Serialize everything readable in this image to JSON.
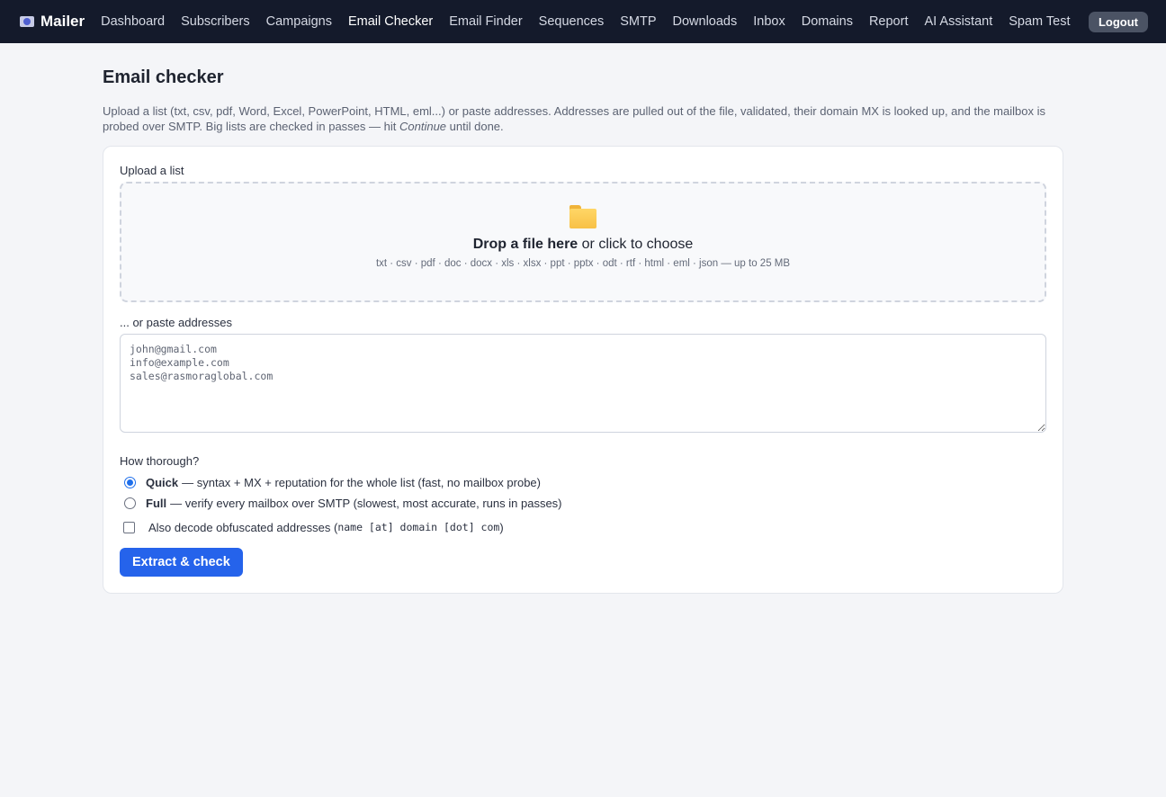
{
  "nav": {
    "brand": "Mailer",
    "links": [
      "Dashboard",
      "Subscribers",
      "Campaigns",
      "Email Checker",
      "Email Finder",
      "Sequences",
      "SMTP",
      "Downloads",
      "Inbox",
      "Domains",
      "Report",
      "AI Assistant",
      "Spam Test"
    ],
    "active": "Email Checker",
    "logout_label": "Logout"
  },
  "page": {
    "title": "Email checker",
    "desc_main": "Upload a list (txt, csv, pdf, Word, Excel, PowerPoint, HTML, eml...) or paste addresses. Addresses are pulled out of the file, validated, their domain MX is looked up, and the mailbox is probed over SMTP. Big lists are checked in passes — hit ",
    "desc_emphasis": "Continue",
    "desc_tail": " until done."
  },
  "upload": {
    "label": "Upload a list",
    "drop_bold": "Drop a file here",
    "drop_rest": " or click to choose",
    "formats": "txt · csv · pdf · doc · docx · xls · xlsx · ppt · pptx · odt · rtf · html · eml · json — up to 25 MB"
  },
  "paste": {
    "label": "... or paste addresses",
    "placeholder": "john@gmail.com\ninfo@example.com\nsales@rasmoraglobal.com"
  },
  "thorough": {
    "label": "How thorough?",
    "options": [
      {
        "name": "Quick",
        "desc": "— syntax + MX + reputation for the whole list (fast, no mailbox probe)",
        "selected": true
      },
      {
        "name": "Full",
        "desc": "— verify every mailbox over SMTP (slowest, most accurate, runs in passes)",
        "selected": false
      }
    ]
  },
  "decode": {
    "label": "Also decode obfuscated addresses (",
    "example": "name [at] domain [dot] com",
    "close": ")",
    "checked": false
  },
  "submit_label": "Extract & check",
  "colors": {
    "nav_bg": "#141a2b",
    "accent": "#2563eb",
    "page_bg": "#f4f5f8"
  }
}
